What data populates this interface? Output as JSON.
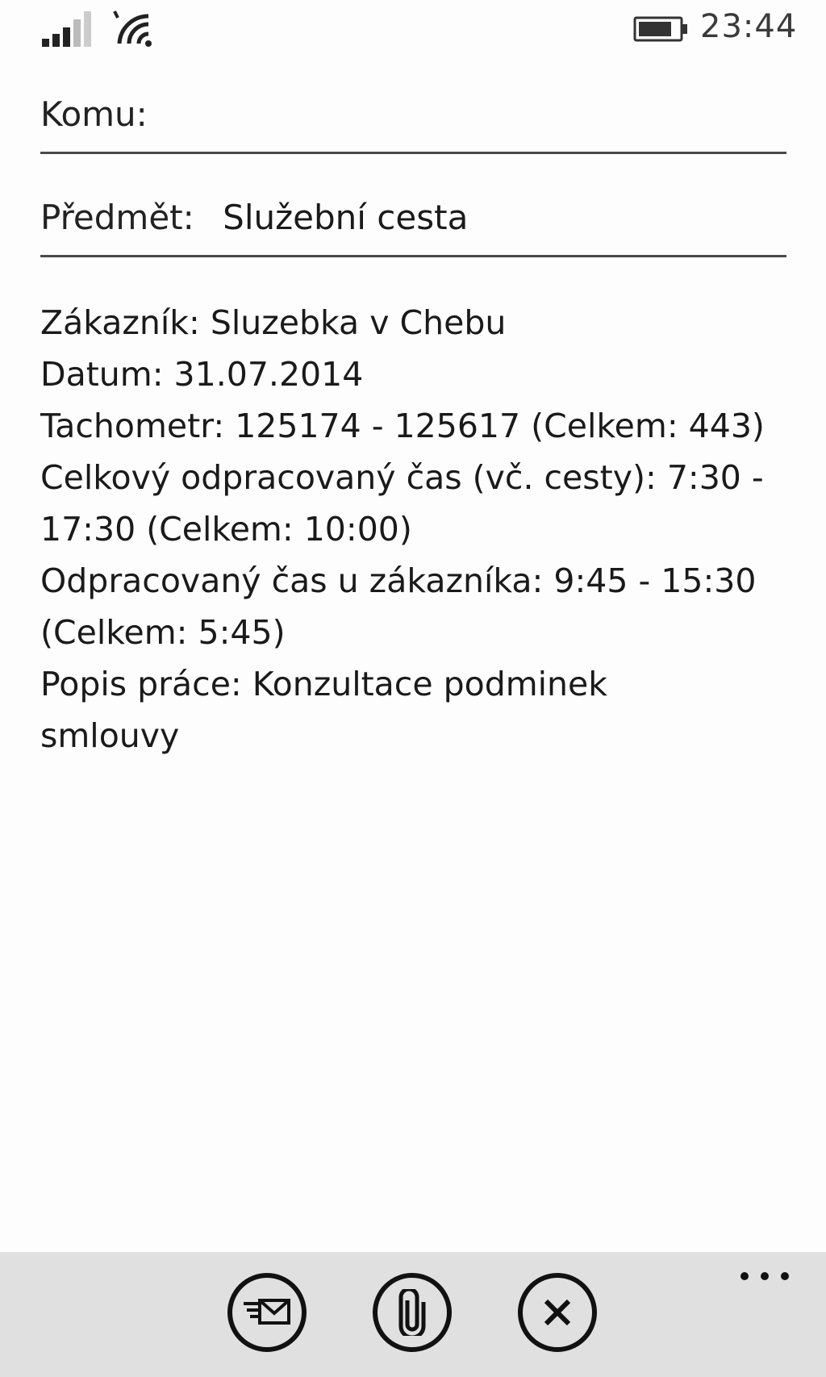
{
  "status_bar": {
    "time": "23:44",
    "signal_icon": "cell-signal-icon",
    "wifi_icon": "wifi-icon",
    "battery_icon": "battery-icon"
  },
  "compose": {
    "to_label": "Komu:",
    "to_value": "",
    "subject_label": "Předmět:",
    "subject_value": "Služební cesta"
  },
  "body": {
    "lines": [
      "Zákazník: Sluzebka v Chebu",
      "Datum: 31.07.2014",
      "Tachometr: 125174 - 125617 (Celkem: 443)",
      "Celkový odpracovaný čas (vč. cesty): 7:30 -",
      "17:30 (Celkem: 10:00)",
      "Odpracovaný čas u zákazníka: 9:45 - 15:30",
      "(Celkem: 5:45)",
      "Popis práce: Konzultace podminek",
      "smlouvy"
    ]
  },
  "app_bar": {
    "buttons": [
      {
        "icon": "send-icon"
      },
      {
        "icon": "attach-icon"
      },
      {
        "icon": "discard-icon"
      }
    ],
    "more_icon": "more-ellipsis-icon"
  },
  "colors": {
    "background": "#fdfdfd",
    "app_bar_background": "#e0e0e0",
    "text": "#1a1a1a",
    "underline": "#4a4a4a"
  }
}
